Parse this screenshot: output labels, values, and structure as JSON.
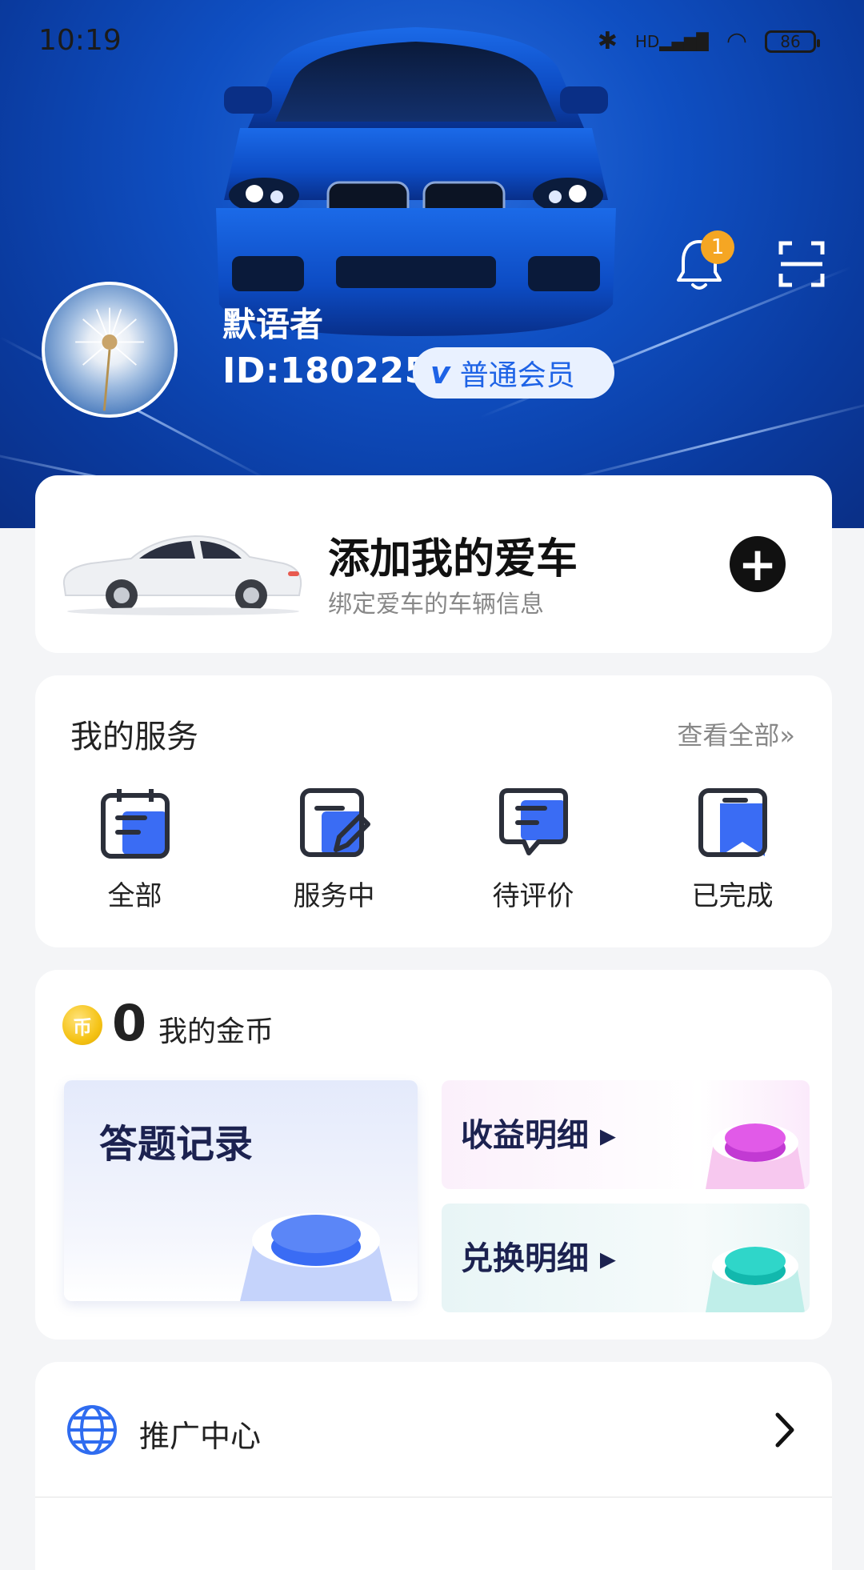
{
  "status_bar": {
    "time": "10:19",
    "network": "HD",
    "battery": "86"
  },
  "header": {
    "notification_count": "1",
    "username": "默语者",
    "user_id": "ID:180225",
    "membership": "普通会员"
  },
  "add_car": {
    "title": "添加我的爱车",
    "subtitle": "绑定爱车的车辆信息"
  },
  "services": {
    "title": "我的服务",
    "view_all": "查看全部»",
    "items": [
      {
        "label": "全部",
        "icon": "calendar-list-icon"
      },
      {
        "label": "服务中",
        "icon": "edit-note-icon"
      },
      {
        "label": "待评价",
        "icon": "comment-icon"
      },
      {
        "label": "已完成",
        "icon": "bookmark-icon"
      }
    ]
  },
  "coins": {
    "icon_text": "币",
    "amount": "0",
    "label": "我的金币",
    "tiles": {
      "answers": "答题记录",
      "income": "收益明细 ▸",
      "exchange": "兑换明细 ▸"
    }
  },
  "menu": {
    "items": [
      {
        "label": "推广中心",
        "icon": "globe-icon"
      }
    ]
  },
  "colors": {
    "brand_blue": "#1e63e6",
    "banner_blue": "#0f4fc2",
    "badge_orange": "#f5a623",
    "coin_gold": "#f5c316"
  }
}
